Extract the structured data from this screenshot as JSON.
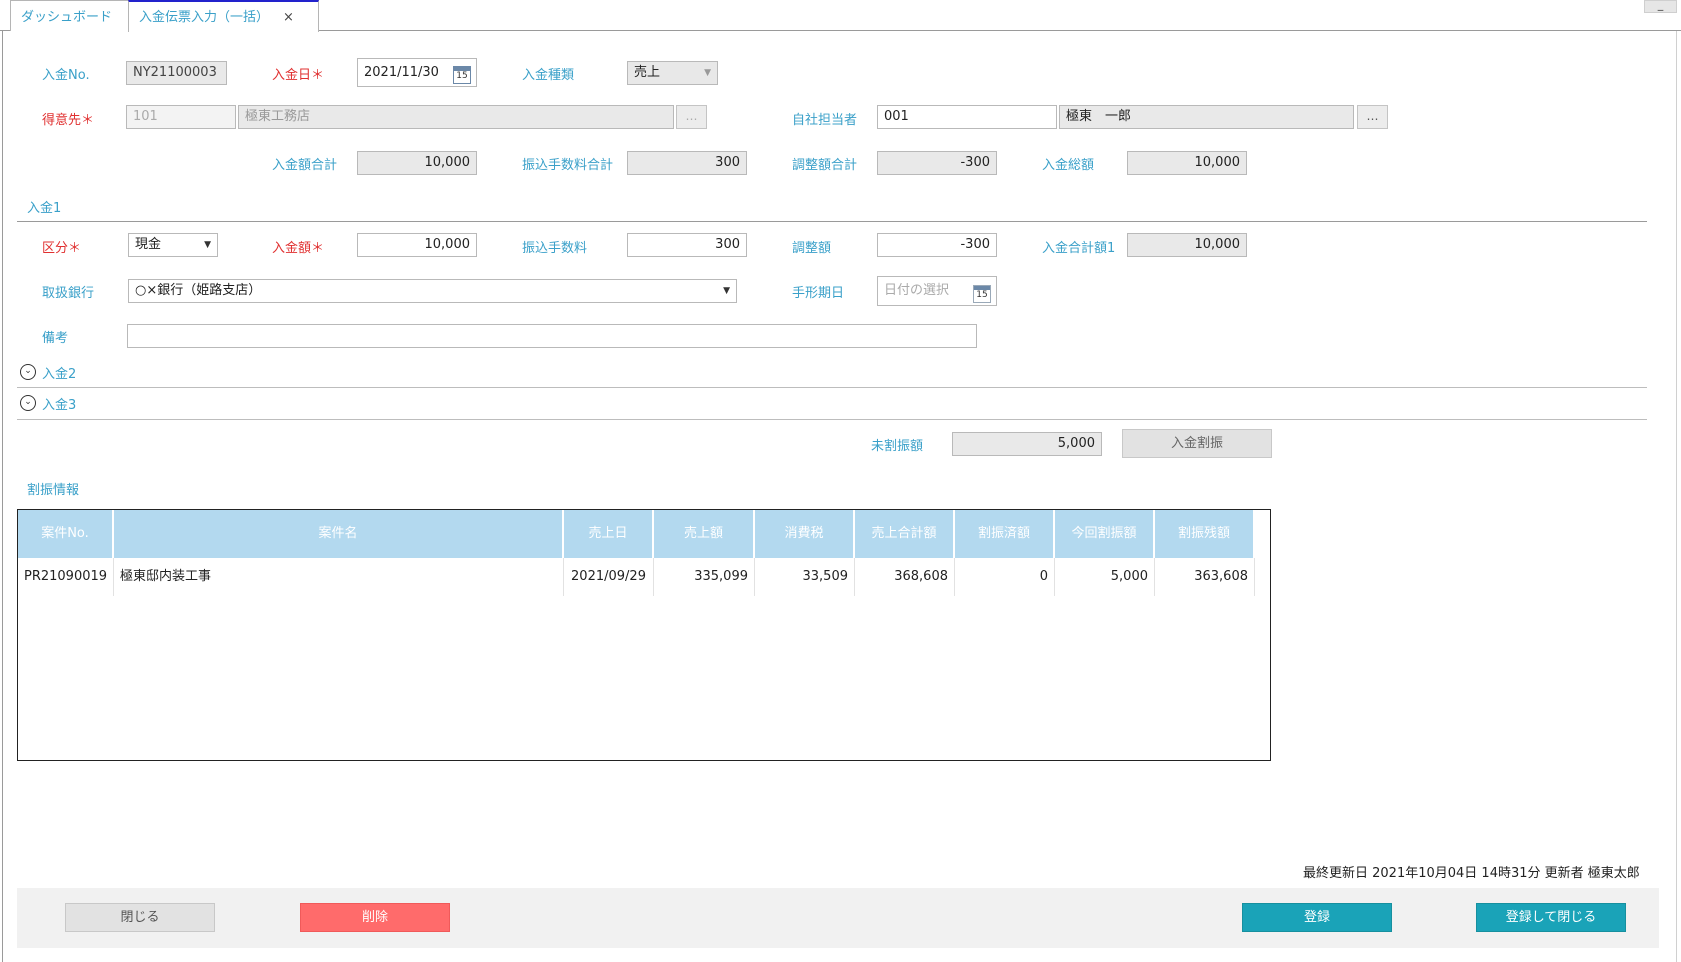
{
  "tabs": [
    {
      "label": "ダッシュボード",
      "active": false
    },
    {
      "label": "入金伝票入力（一括）",
      "active": true,
      "close": "×"
    }
  ],
  "window": {
    "minimize": "_"
  },
  "header": {
    "no_label": "入金No.",
    "no_value": "NY21100003",
    "date_label": "入金日",
    "date_value": "2021/11/30",
    "type_label": "入金種類",
    "type_value": "売上",
    "customer_label": "得意先",
    "customer_code": "101",
    "customer_name": "極東工務店",
    "staff_label": "自社担当者",
    "staff_code": "001",
    "staff_name": "極東　一郎",
    "dots": "…",
    "required_mark": "＊"
  },
  "totals": {
    "deposit_total_label": "入金額合計",
    "deposit_total": "10,000",
    "fee_total_label": "振込手数料合計",
    "fee_total": "300",
    "adjust_total_label": "調整額合計",
    "adjust_total": "-300",
    "grand_total_label": "入金総額",
    "grand_total": "10,000"
  },
  "payment1": {
    "title": "入金1",
    "category_label": "区分",
    "category_value": "現金",
    "amount_label": "入金額",
    "amount_value": "10,000",
    "fee_label": "振込手数料",
    "fee_value": "300",
    "adjust_label": "調整額",
    "adjust_value": "-300",
    "sum_label": "入金合計額1",
    "sum_value": "10,000",
    "bank_label": "取扱銀行",
    "bank_value": "○×銀行（姫路支店）",
    "due_label": "手形期日",
    "due_placeholder": "日付の選択",
    "memo_label": "備考",
    "memo_value": ""
  },
  "payment2": {
    "title": "入金2"
  },
  "payment3": {
    "title": "入金3"
  },
  "allocation": {
    "unallocated_label": "未割振額",
    "unallocated_value": "5,000",
    "allocate_button": "入金割振",
    "section_title": "割振情報",
    "columns": [
      "案件No.",
      "案件名",
      "売上日",
      "売上額",
      "消費税",
      "売上合計額",
      "割振済額",
      "今回割振額",
      "割振残額"
    ],
    "rows": [
      [
        "PR21090019",
        "極東邸内装工事",
        "2021/09/29",
        "335,099",
        "33,509",
        "368,608",
        "0",
        "5,000",
        "363,608"
      ]
    ]
  },
  "calendar_day": "15",
  "footer": {
    "last_updated": "最終更新日 2021年10月04日 14時31分 更新者 極東太郎",
    "close_button": "閉じる",
    "delete_button": "削除",
    "save_button": "登録",
    "save_close_button": "登録して閉じる"
  },
  "colors": {
    "label": "#3aa0c9",
    "required": "#e03030",
    "header_bg": "#b3d9ef",
    "delete": "#ff6b6b",
    "primary": "#1aa3b8"
  }
}
